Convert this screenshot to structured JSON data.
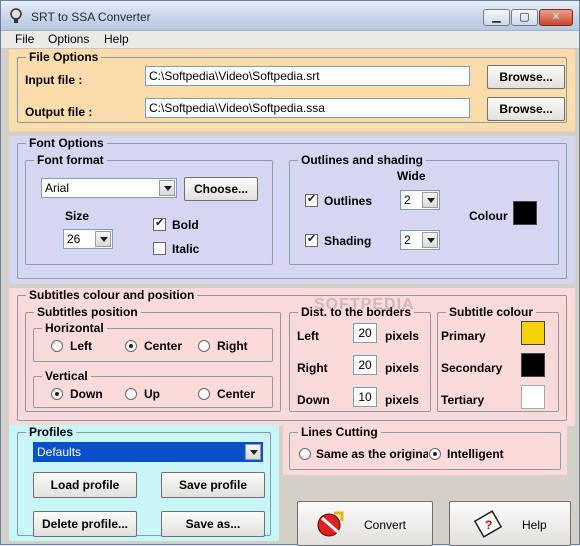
{
  "window": {
    "title": "SRT to SSA Converter"
  },
  "menu": {
    "items": [
      "File",
      "Options",
      "Help"
    ]
  },
  "file_options": {
    "legend": "File Options",
    "input_label": "Input file :",
    "input_value": "C:\\Softpedia\\Video\\Softpedia.srt",
    "output_label": "Output file :",
    "output_value": "C:\\Softpedia\\Video\\Softpedia.ssa",
    "browse_label": "Browse..."
  },
  "font_options": {
    "legend": "Font Options",
    "format_legend": "Font format",
    "font_value": "Arial",
    "choose_label": "Choose...",
    "size_label": "Size",
    "size_value": "26",
    "bold_label": "Bold",
    "italic_label": "Italic",
    "outline_legend": "Outlines and shading",
    "wide_label": "Wide",
    "outlines_label": "Outlines",
    "outlines_value": "2",
    "shading_label": "Shading",
    "shading_value": "2",
    "colour_label": "Colour",
    "colour": "#000000"
  },
  "subtitles": {
    "legend": "Subtitles colour and position",
    "position_legend": "Subtitles position",
    "horizontal_legend": "Horizontal",
    "left_label": "Left",
    "center_label": "Center",
    "right_label": "Right",
    "vertical_legend": "Vertical",
    "down_label": "Down",
    "up_label": "Up",
    "vcenter_label": "Center",
    "dist_legend": "Dist. to the borders",
    "dist_left_label": "Left",
    "dist_left_value": "20",
    "dist_right_label": "Right",
    "dist_right_value": "20",
    "dist_down_label": "Down",
    "dist_down_value": "10",
    "pixels_label": "pixels",
    "colour_legend": "Subtitle colour",
    "primary_label": "Primary",
    "primary_color": "#f5d20a",
    "secondary_label": "Secondary",
    "secondary_color": "#000000",
    "tertiary_label": "Tertiary",
    "tertiary_color": "#ffffff"
  },
  "profiles": {
    "legend": "Profiles",
    "selected": "Defaults",
    "load_label": "Load profile",
    "save_label": "Save profile",
    "delete_label": "Delete profile...",
    "saveas_label": "Save as..."
  },
  "lines_cutting": {
    "legend": "Lines Cutting",
    "same_label": "Same as the origina",
    "intelligent_label": "Intelligent"
  },
  "actions": {
    "convert_label": "Convert",
    "help_label": "Help"
  },
  "watermark": "SOFTPEDIA"
}
